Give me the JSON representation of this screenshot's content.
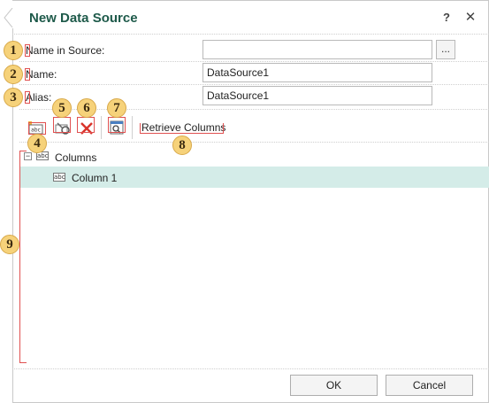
{
  "dialog": {
    "title": "New Data Source",
    "help_label": "?",
    "close_label": "✕"
  },
  "fields": {
    "name_in_source": {
      "label": "Name in Source:",
      "value": ""
    },
    "browse_label": "...",
    "name": {
      "label": "Name:",
      "value": "DataSource1"
    },
    "alias": {
      "label": "Alias:",
      "value": "DataSource1"
    }
  },
  "toolbar": {
    "new_column_icon": "new-column-icon",
    "edit_icon": "edit-icon",
    "delete_icon": "delete-icon",
    "view_data_icon": "view-data-icon",
    "retrieve_columns_label": "Retrieve Columns"
  },
  "tree": {
    "root_label": "Columns",
    "collapse_glyph": "−",
    "abc_glyph": "abc",
    "items": [
      {
        "label": "Column 1",
        "selected": true
      }
    ]
  },
  "callouts": [
    "1",
    "2",
    "3",
    "4",
    "5",
    "6",
    "7",
    "8",
    "9"
  ],
  "footer": {
    "ok_label": "OK",
    "cancel_label": "Cancel"
  },
  "colors": {
    "title": "#1e5a4a",
    "selected_row": "#d4ece8",
    "callout_fill": "#f6d27a",
    "annotation_box": "#e05050"
  }
}
